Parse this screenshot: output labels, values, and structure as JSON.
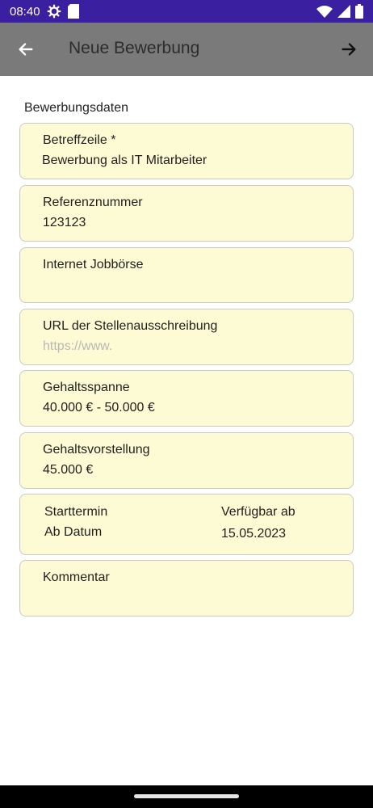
{
  "status": {
    "time": "08:40",
    "bar_color": "#3a1fa0",
    "icons": [
      "settings-icon",
      "sim-card-icon",
      "wifi-icon",
      "signal-icon",
      "battery-icon"
    ]
  },
  "app_bar": {
    "title": "Neue Bewerbung",
    "back_icon": "arrow-left-icon",
    "forward_icon": "arrow-right-icon",
    "color": "#7a7a7a"
  },
  "section": {
    "heading": "Bewerbungsdaten"
  },
  "fields": {
    "subject": {
      "label": "Betreffzeile *",
      "value": "Bewerbung als IT Mitarbeiter"
    },
    "reference": {
      "label": "Referenznummer",
      "value": "123123"
    },
    "job_board": {
      "label": "Internet Jobbörse",
      "value": ""
    },
    "url": {
      "label": "URL der Stellenausschreibung",
      "placeholder": "https://www."
    },
    "salary_range": {
      "label": "Gehaltsspanne",
      "value": "40.000 € - 50.000 €"
    },
    "salary_expectation": {
      "label": "Gehaltsvorstellung",
      "value": "45.000 €"
    },
    "start": {
      "label": "Starttermin",
      "value": "Ab Datum"
    },
    "available": {
      "label": "Verfügbar ab",
      "value": "15.05.2023"
    },
    "comment": {
      "label": "Kommentar",
      "value": ""
    }
  },
  "theme": {
    "card_background": "#fdfbd3",
    "card_border": "#c9c9c9"
  }
}
